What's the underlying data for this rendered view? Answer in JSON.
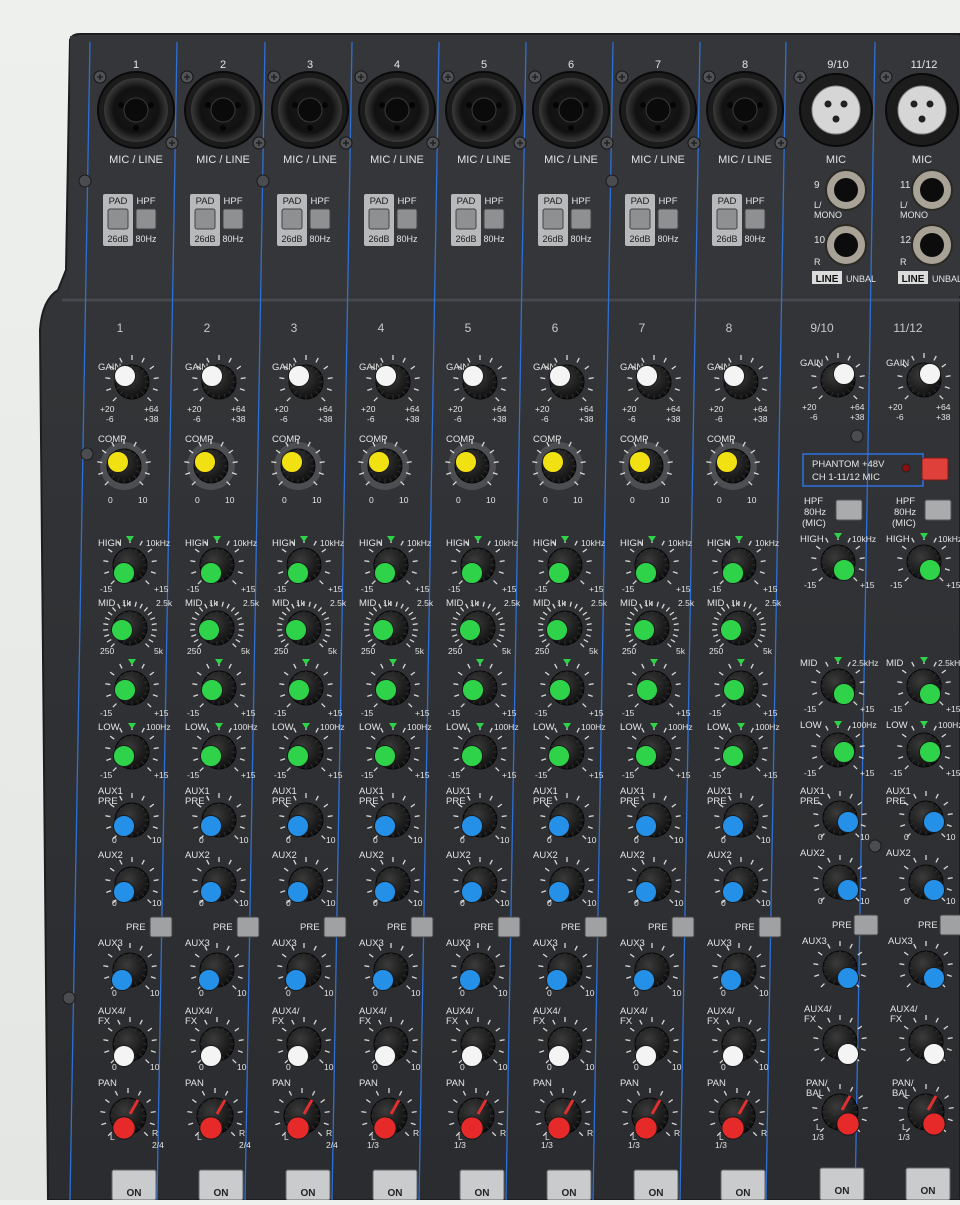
{
  "mixer": {
    "inputs": {
      "ch1": "1",
      "ch2": "2",
      "ch3": "3",
      "ch4": "4",
      "ch5": "5",
      "ch6": "6",
      "ch7": "7",
      "ch8": "8",
      "ch910": "9/10",
      "ch1112": "11/12",
      "mic_line": "MIC / LINE",
      "mic": "MIC",
      "pad": "PAD",
      "pad_value": "26dB",
      "hpf": "HPF",
      "hpf_value": "80Hz",
      "line_9": "9",
      "line_10": "10",
      "line_11": "11",
      "line_12": "12",
      "l_mono": "L/",
      "mono": "MONO",
      "r": "R",
      "line_badge": "LINE",
      "unbal": "UNBAL"
    },
    "controls": {
      "gain": "GAIN",
      "gain_scale_left_top": "+20",
      "gain_scale_left_bot": "-6",
      "gain_scale_right_top": "+64",
      "gain_scale_right_bot": "+38",
      "comp": "COMP",
      "comp_min": "0",
      "comp_max": "10",
      "phantom_line1": "PHANTOM +48V",
      "phantom_line2": "CH 1-11/12 MIC",
      "hpf_mic_1": "HPF",
      "hpf_mic_2": "80Hz",
      "hpf_mic_3": "(MIC)",
      "high": "HIGH",
      "high_freq": "10kHz",
      "eq_min": "-15",
      "eq_max": "+15",
      "mid": "MID",
      "mid_1k": "1k",
      "mid_25k": "2.5k",
      "mid_250": "250",
      "mid_5k": "5k",
      "mid_stereo_freq": "2.5kHz",
      "low": "LOW",
      "low_freq": "100Hz",
      "aux1": "AUX1",
      "pre": "PRE",
      "aux2": "AUX2",
      "aux3": "AUX3",
      "aux4": "AUX4/",
      "fx": "FX",
      "aux_min": "0",
      "aux_max": "10",
      "pan": "PAN",
      "pan_bal_1": "PAN/",
      "pan_bal_2": "BAL",
      "pan_l": "L",
      "pan_r": "R",
      "pan_13": "1/3",
      "pan_24": "2/4",
      "on": "ON"
    },
    "colors": {
      "panel": "#2c2e31",
      "channel_line": "#2f6fd6",
      "knob_green": "#2fd34a",
      "knob_blue": "#2590e8",
      "knob_yellow": "#f1e012",
      "knob_red": "#e62a2a",
      "knob_white": "#f4f4f4",
      "phantom_red": "#e0403a"
    }
  }
}
